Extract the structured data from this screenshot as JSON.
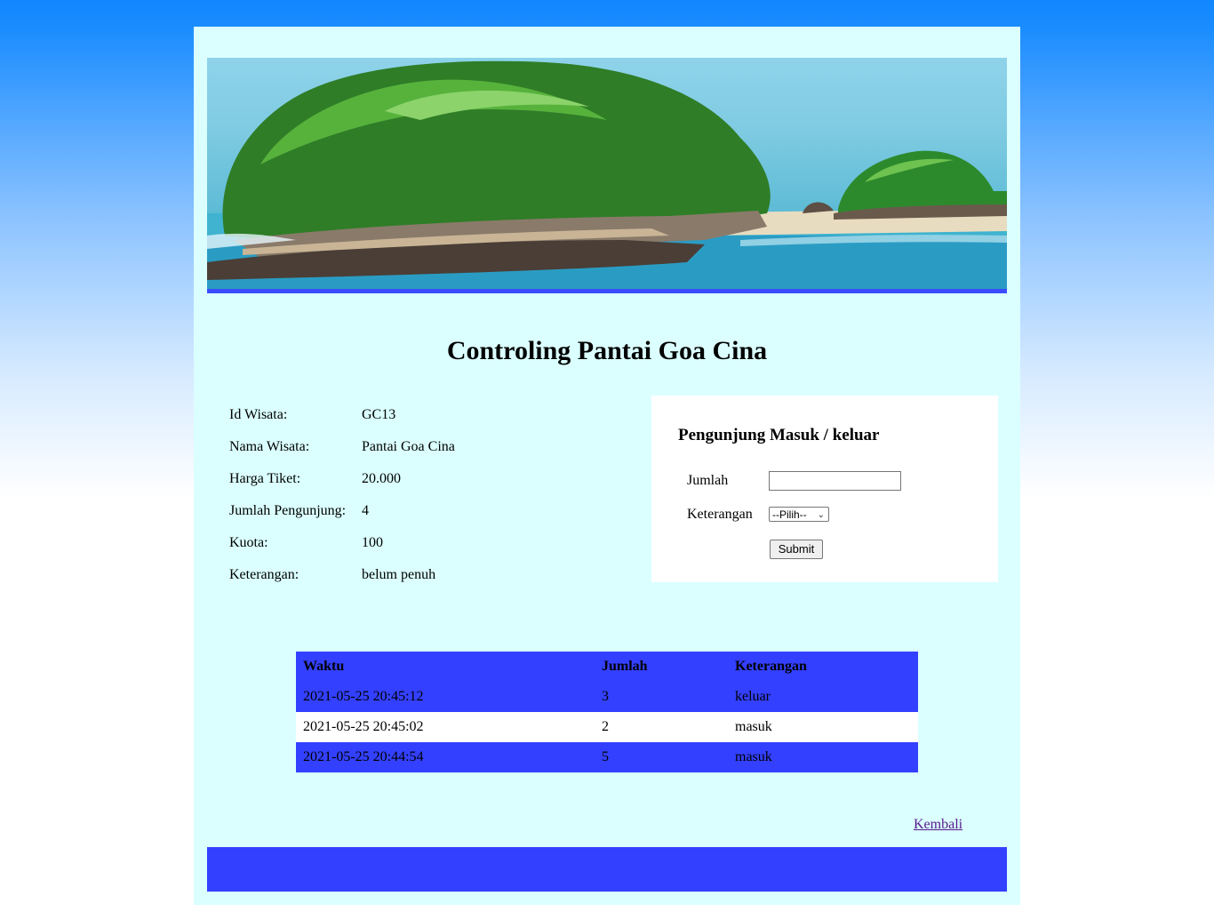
{
  "page": {
    "title": "Controling Pantai Goa Cina",
    "background_color": "#dbffff",
    "accent_color": "#3340ff"
  },
  "banner": {
    "image": "beach-island-photo"
  },
  "info": {
    "rows": [
      {
        "label": "Id Wisata:",
        "value": "GC13"
      },
      {
        "label": "Nama Wisata:",
        "value": "Pantai Goa Cina"
      },
      {
        "label": "Harga Tiket:",
        "value": "20.000"
      },
      {
        "label": "Jumlah Pengunjung:",
        "value": "4"
      },
      {
        "label": "Kuota:",
        "value": "100"
      },
      {
        "label": "Keterangan:",
        "value": "belum penuh"
      }
    ]
  },
  "form": {
    "title": "Pengunjung Masuk / keluar",
    "jumlah_label": "Jumlah",
    "jumlah_value": "",
    "keterangan_label": "Keterangan",
    "keterangan_selected": "--Pilih--",
    "submit_label": "Submit"
  },
  "log": {
    "headers": [
      "Waktu",
      "Jumlah",
      "Keterangan"
    ],
    "rows": [
      [
        "2021-05-25 20:45:12",
        "3",
        "keluar"
      ],
      [
        "2021-05-25 20:45:02",
        "2",
        "masuk"
      ],
      [
        "2021-05-25 20:44:54",
        "5",
        "masuk"
      ]
    ]
  },
  "nav": {
    "back_label": "Kembali"
  }
}
